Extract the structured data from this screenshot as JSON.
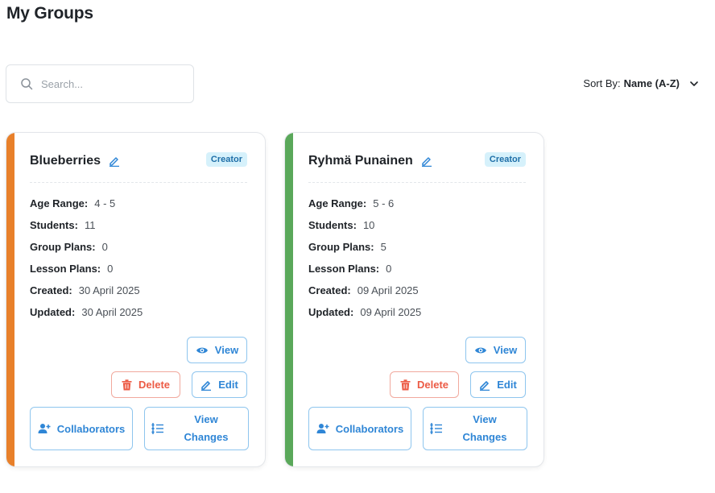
{
  "page": {
    "title": "My Groups"
  },
  "search": {
    "placeholder": "Search..."
  },
  "sort": {
    "label": "Sort By:",
    "value": "Name (A-Z)"
  },
  "colors": {
    "accent_orange": "#e8802a",
    "accent_green": "#5aa85a",
    "primary": "#2f86d6",
    "danger": "#ec5b45",
    "badge_bg": "#d6f1fb"
  },
  "labels": {
    "age_range": "Age Range:",
    "students": "Students:",
    "group_plans": "Group Plans:",
    "lesson_plans": "Lesson Plans:",
    "created": "Created:",
    "updated": "Updated:"
  },
  "buttons": {
    "view": "View",
    "delete": "Delete",
    "edit": "Edit",
    "collaborators": "Collaborators",
    "view_changes_line1": "View",
    "view_changes_line2": "Changes"
  },
  "groups": [
    {
      "name": "Blueberries",
      "badge": "Creator",
      "age_range": "4 - 5",
      "students": "11",
      "group_plans": "0",
      "lesson_plans": "0",
      "created": "30 April 2025",
      "updated": "30 April 2025"
    },
    {
      "name": "Ryhmä Punainen",
      "badge": "Creator",
      "age_range": "5 - 6",
      "students": "10",
      "group_plans": "5",
      "lesson_plans": "0",
      "created": "09 April 2025",
      "updated": "09 April 2025"
    }
  ]
}
